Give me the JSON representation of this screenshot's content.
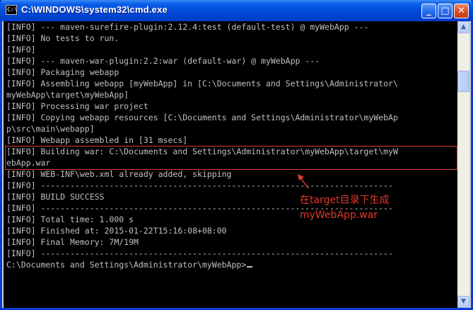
{
  "window": {
    "title": "C:\\WINDOWS\\system32\\cmd.exe",
    "icon_name": "console-app-icon",
    "icon_glyph": "C:\\"
  },
  "title_buttons": {
    "minimize": "_",
    "maximize": "□",
    "close": "✕"
  },
  "console": {
    "lines": [
      "[INFO] --- maven-surefire-plugin:2.12.4:test (default-test) @ myWebApp ---",
      "[INFO] No tests to run.",
      "[INFO]",
      "[INFO] --- maven-war-plugin:2.2:war (default-war) @ myWebApp ---",
      "[INFO] Packaging webapp",
      "[INFO] Assembling webapp [myWebApp] in [C:\\Documents and Settings\\Administrator\\",
      "myWebApp\\target\\myWebApp]",
      "[INFO] Processing war project",
      "[INFO] Copying webapp resources [C:\\Documents and Settings\\Administrator\\myWebAp",
      "p\\src\\main\\webapp]",
      "[INFO] Webapp assembled in [31 msecs]",
      "[INFO] Building war: C:\\Documents and Settings\\Administrator\\myWebApp\\target\\myW",
      "ebApp.war",
      "[INFO] WEB-INF\\web.xml already added, skipping",
      "[INFO] ------------------------------------------------------------------------",
      "[INFO] BUILD SUCCESS",
      "[INFO] ------------------------------------------------------------------------",
      "[INFO] Total time: 1.000 s",
      "[INFO] Finished at: 2015-01-22T15:16:08+08:00",
      "[INFO] Final Memory: 7M/19M",
      "[INFO] ------------------------------------------------------------------------",
      "C:\\Documents and Settings\\Administrator\\myWebApp>"
    ]
  },
  "annotation": {
    "line1": "在target目录下生成",
    "line2": "myWebApp.war"
  },
  "scrollbar": {
    "up": "▲",
    "down": "▼"
  },
  "colors": {
    "console_bg": "#000000",
    "console_text": "#c0c0c0",
    "highlight": "#e0392c",
    "titlebar": "#0049d9"
  }
}
